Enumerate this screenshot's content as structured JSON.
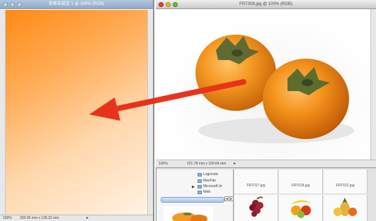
{
  "left_window": {
    "title": "名称未設定 1 @ 100% (RGB)",
    "status_zoom": "100%",
    "status_size": "200.00 mm x 135.22 mm"
  },
  "right_window": {
    "title": "FRT008.jpg @ 100% (RGB)",
    "status_zoom": "100%",
    "status_size": "221.78 mm x 150.64 mm"
  },
  "browser": {
    "folders": [
      "Logicools",
      "MacFan",
      "Microsoft Ur",
      "Web"
    ],
    "thumbnails": [
      "FRT017.jpg",
      "FRT018.jpg",
      "FRT022.jpg"
    ]
  },
  "colors": {
    "arrow": "#e8331c",
    "gradient_start": "#ff8a14",
    "persimmon": "#f08a18"
  }
}
